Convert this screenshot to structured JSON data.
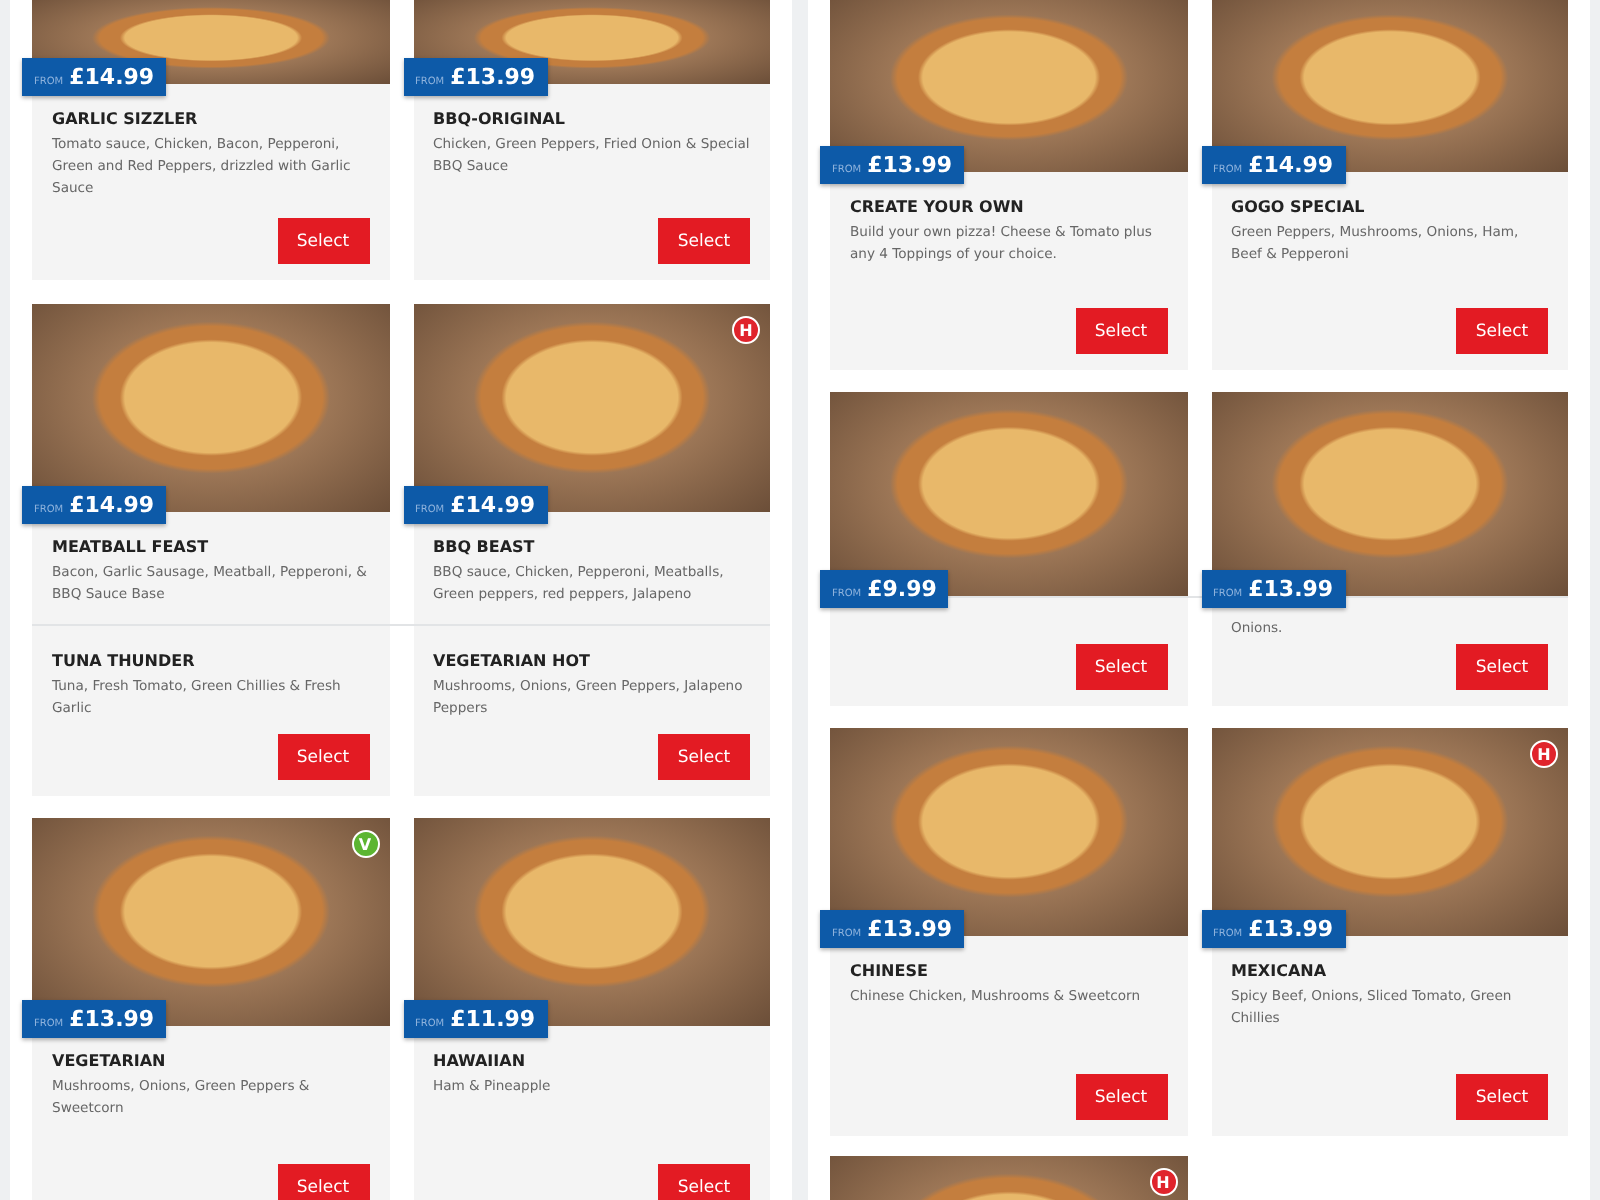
{
  "panels": [
    {
      "rows": [
        {
          "kind": "short-photo",
          "cards": [
            {
              "from": "FROM",
              "price": "£14.99",
              "name": "GARLIC SIZZLER",
              "description": "Tomato sauce, Chicken, Bacon, Pepperoni, Green and Red Peppers, drizzled with Garlic Sauce",
              "button": "Select"
            },
            {
              "from": "FROM",
              "price": "£13.99",
              "name": "BBQ-ORIGINAL",
              "description": "Chicken, Green Peppers, Fried Onion & Special BBQ Sauce",
              "button": "Select"
            }
          ]
        },
        {
          "kind": "cut-text",
          "cards": [
            {
              "from": "FROM",
              "price": "£14.99",
              "name": "MEATBALL FEAST",
              "description": "Bacon, Garlic Sausage, Meatball, Pepperoni, & BBQ Sauce Base"
            },
            {
              "from": "FROM",
              "price": "£14.99",
              "name": "BBQ BEAST",
              "description": "BBQ sauce, Chicken, Pepperoni, Meatballs, Green peppers, red peppers, Jalapeno",
              "badge": {
                "text": "H",
                "color": "#e0242c"
              }
            }
          ]
        },
        {
          "kind": "no-photo",
          "cards": [
            {
              "name": "TUNA THUNDER",
              "description": "Tuna, Fresh Tomato, Green Chillies & Fresh Garlic",
              "button": "Select"
            },
            {
              "name": "VEGETARIAN HOT",
              "description": "Mushrooms, Onions, Green Peppers, Jalapeno Peppers",
              "button": "Select"
            }
          ]
        },
        {
          "kind": "full",
          "cards": [
            {
              "from": "FROM",
              "price": "£13.99",
              "name": "VEGETARIAN",
              "description": "Mushrooms, Onions, Green Peppers & Sweetcorn",
              "button": "Select",
              "badge": {
                "text": "V",
                "color": "#5cb531"
              }
            },
            {
              "from": "FROM",
              "price": "£11.99",
              "name": "HAWAIIAN",
              "description": "Ham & Pineapple",
              "button": "Select"
            }
          ]
        }
      ]
    },
    {
      "rows": [
        {
          "kind": "cropped-photo",
          "cards": [
            {
              "from": "FROM",
              "price": "£13.99",
              "name": "CREATE YOUR OWN",
              "description": "Build your own pizza! Cheese & Tomato plus any 4 Toppings of your choice.",
              "button": "Select"
            },
            {
              "from": "FROM",
              "price": "£14.99",
              "name": "GOGO SPECIAL",
              "description": "Green Peppers, Mushrooms, Onions, Ham, Beef & Pepperoni",
              "button": "Select"
            }
          ]
        },
        {
          "kind": "photo-only",
          "cards": [
            {
              "from": "FROM",
              "price": "£9.99"
            },
            {
              "from": "FROM",
              "price": "£13.99"
            }
          ]
        },
        {
          "kind": "text-tail",
          "cards": [
            {
              "button": "Select"
            },
            {
              "description": "Onions.",
              "button": "Select"
            }
          ]
        },
        {
          "kind": "full",
          "cards": [
            {
              "from": "FROM",
              "price": "£13.99",
              "name": "CHINESE",
              "description": "Chinese Chicken, Mushrooms & Sweetcorn",
              "button": "Select"
            },
            {
              "from": "FROM",
              "price": "£13.99",
              "name": "MEXICANA",
              "description": "Spicy Beef, Onions, Sliced Tomato, Green Chillies",
              "button": "Select",
              "badge": {
                "text": "H",
                "color": "#e0242c"
              }
            }
          ]
        },
        {
          "kind": "photo-top",
          "cards": [
            {
              "badge": {
                "text": "H",
                "color": "#e0242c"
              }
            }
          ]
        }
      ]
    }
  ]
}
